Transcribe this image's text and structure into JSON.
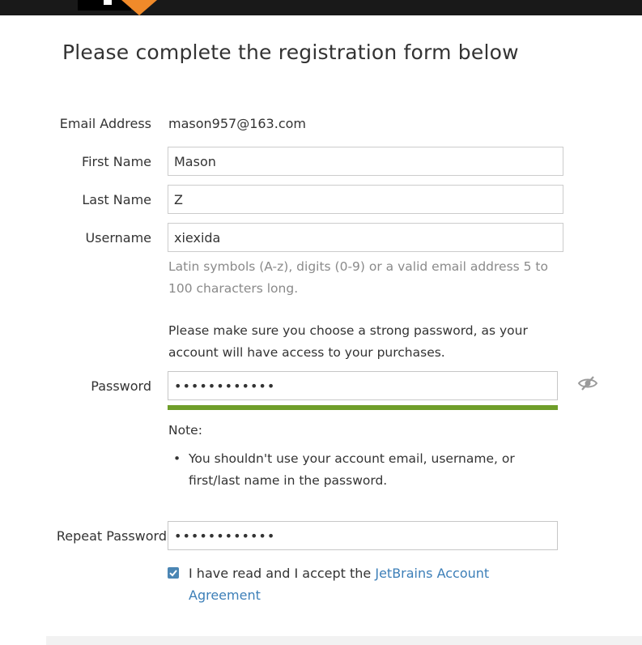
{
  "title": "Please complete the registration form below",
  "email": {
    "label": "Email Address",
    "value": "mason957@163.com"
  },
  "first_name": {
    "label": "First Name",
    "value": "Mason"
  },
  "last_name": {
    "label": "Last Name",
    "value": "Z"
  },
  "username": {
    "label": "Username",
    "value": "xiexida",
    "hint": "Latin symbols (A-z), digits (0-9) or a valid email address 5 to 100 characters long."
  },
  "password_info": "Please make sure you choose a strong password, as your account will have access to your purchases.",
  "password": {
    "label": "Password",
    "value": "••••••••••••",
    "strength_percent": 100,
    "strength_color": "#6f9e2a",
    "toggle_icon": "eye-slash-icon"
  },
  "note": {
    "title": "Note:",
    "items": [
      "You shouldn't use your account email, username, or first/last name in the password."
    ]
  },
  "repeat_password": {
    "label": "Repeat Password",
    "value": "••••••••••••"
  },
  "agreement": {
    "checked": true,
    "text": "I have read and I accept the ",
    "link": "JetBrains Account Agreement"
  },
  "colors": {
    "topbar": "#191919",
    "accent_orange": "#f08a2a",
    "link": "#3d7fb8",
    "checkbox": "#4b86b4"
  }
}
